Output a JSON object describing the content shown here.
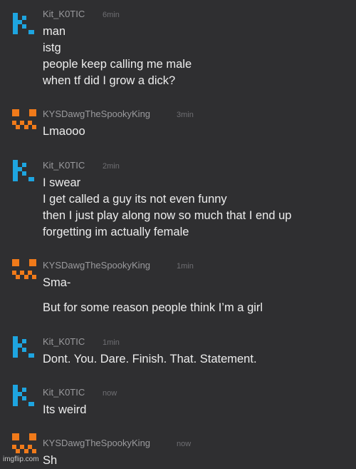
{
  "colors": {
    "background": "#2f2f31",
    "kit_avatar": "#1ea5e0",
    "kys_avatar": "#f07a1a",
    "username_text": "#9a9a9d",
    "timestamp_text": "#6f6f73",
    "message_text": "#ededed"
  },
  "messages": [
    {
      "avatar": "kit-k-logo-icon",
      "username": "Kit_K0TIC",
      "time": "6min",
      "lines": [
        "man",
        "istg",
        "people keep calling me male",
        "when tf did I grow a dick?"
      ]
    },
    {
      "avatar": "pumpkin-face-icon",
      "username": "KYSDawgTheSpookyKing",
      "time": "3min",
      "lines": [
        "Lmaooo"
      ]
    },
    {
      "avatar": "kit-k-logo-icon",
      "username": "Kit_K0TIC",
      "time": "2min",
      "lines": [
        "I swear",
        "I get called a guy its not even funny",
        "then I just play along now so much that I end up",
        "forgetting im actually female"
      ]
    },
    {
      "avatar": "pumpkin-face-icon",
      "username": "KYSDawgTheSpookyKing",
      "time": "1min",
      "lines": [
        "Sma-",
        "But for some reason people think I’m a girl"
      ]
    },
    {
      "avatar": "kit-k-logo-icon",
      "username": "Kit_K0TIC",
      "time": "1min",
      "lines": [
        "Dont. You. Dare. Finish. That. Statement."
      ]
    },
    {
      "avatar": "kit-k-logo-icon",
      "username": "Kit_K0TIC",
      "time": "now",
      "lines": [
        "Its weird"
      ]
    },
    {
      "avatar": "pumpkin-face-icon",
      "username": "KYSDawgTheSpookyKing",
      "time": "now",
      "lines": [
        "Sh"
      ]
    }
  ],
  "watermark": "imgflip.com"
}
